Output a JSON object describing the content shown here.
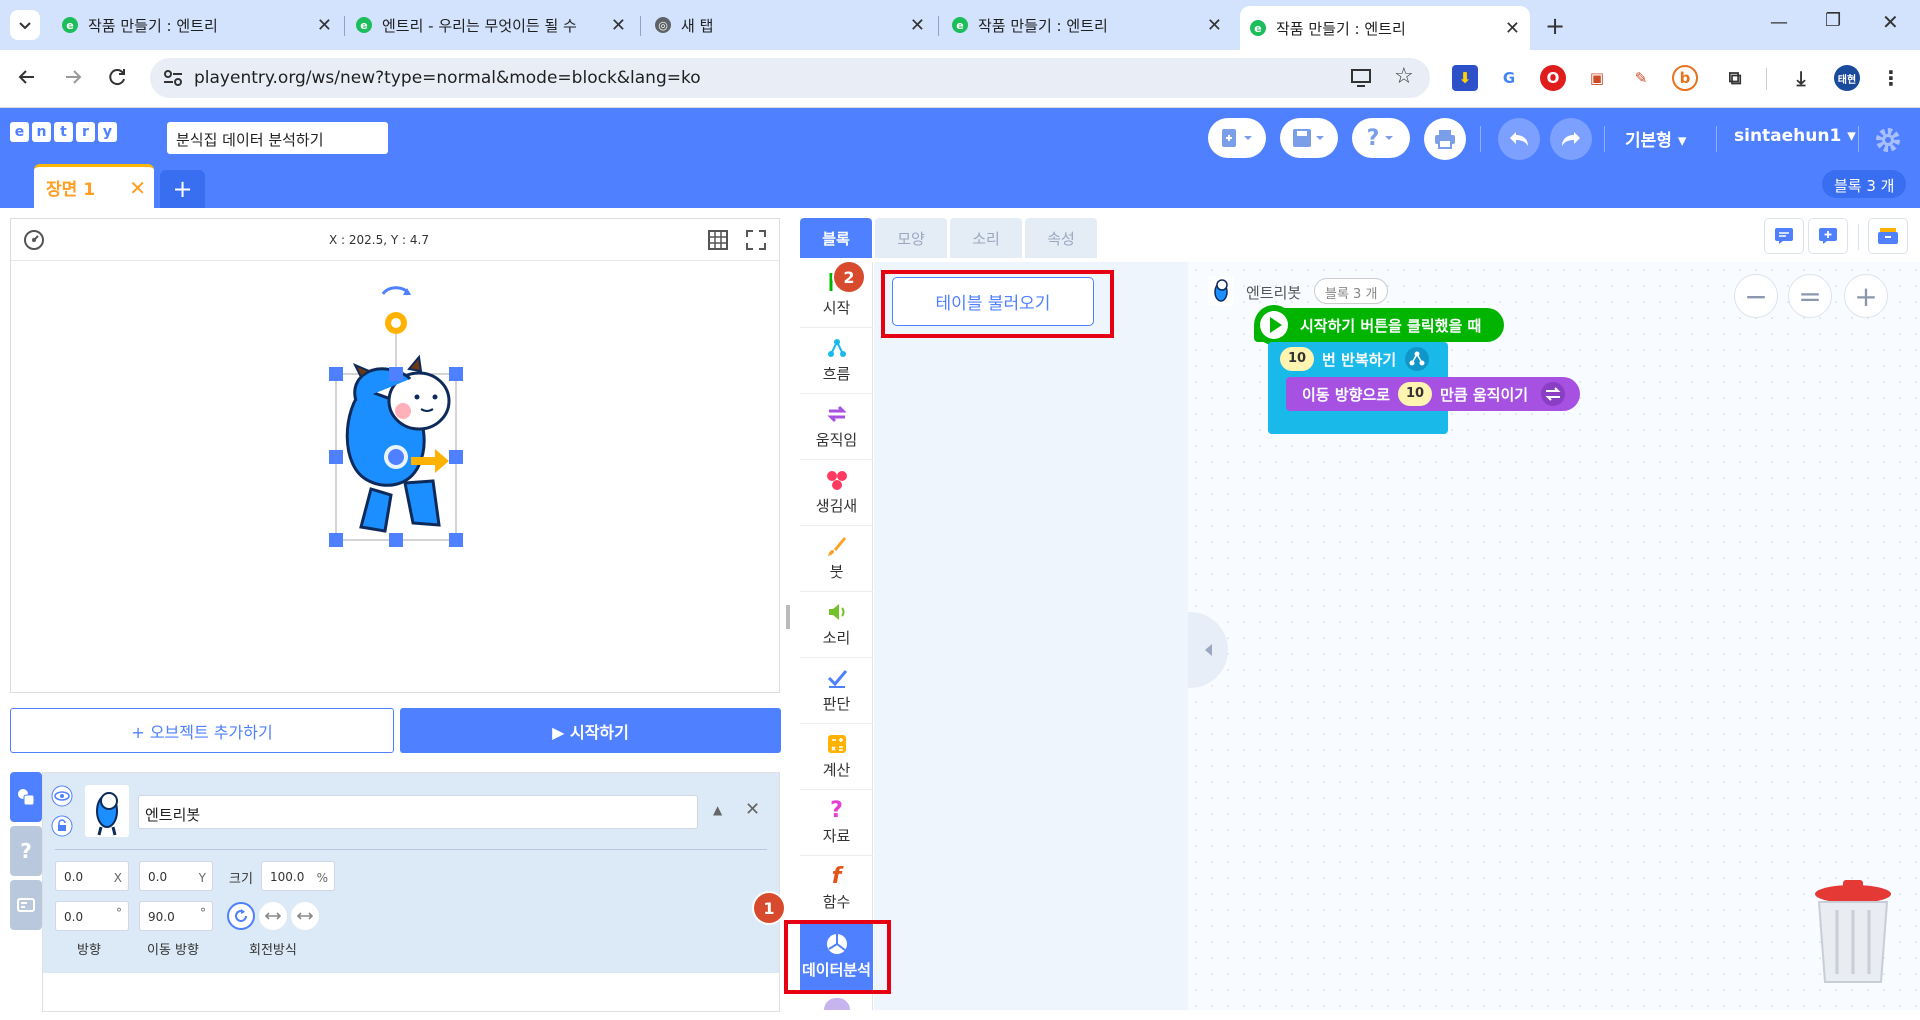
{
  "browser": {
    "tabs": [
      {
        "title": "작품 만들기 : 엔트리"
      },
      {
        "title": "엔트리 - 우리는 무엇이든 될 수"
      },
      {
        "title": "새 탭"
      },
      {
        "title": "작품 만들기 : 엔트리"
      },
      {
        "title": "작품 만들기 : 엔트리"
      }
    ],
    "url": "playentry.org/ws/new?type=normal&mode=block&lang=ko",
    "profile_label": "태현"
  },
  "header": {
    "logo": [
      "e",
      "n",
      "t",
      "r",
      "y"
    ],
    "project_title": "분식집 데이터 분석하기",
    "mode_label": "기본형 ▾",
    "user_label": "sintaehun1 ▾",
    "scene_tab": "장면 1",
    "block_count": "블록 3 개"
  },
  "stage": {
    "coords": "X : 202.5, Y : 4.7",
    "add_object": "+ 오브젝트 추가하기",
    "start": "▶ 시작하기"
  },
  "object": {
    "name": "엔트리봇",
    "x": "0.0",
    "x_unit": "X",
    "y": "0.0",
    "y_unit": "Y",
    "size_label": "크기",
    "size": "100.0",
    "size_unit": "%",
    "direction": "0.0",
    "direction_unit": "°",
    "move_direction": "90.0",
    "move_direction_unit": "°",
    "label_direction": "방향",
    "label_move_direction": "이동 방향",
    "label_rotation": "회전방식"
  },
  "palette": {
    "tabs": [
      "블록",
      "모양",
      "소리",
      "속성"
    ],
    "categories": [
      "시작",
      "흐름",
      "움직임",
      "생김새",
      "붓",
      "소리",
      "판단",
      "계산",
      "자료",
      "함수",
      "데이터분석"
    ],
    "table_load_button": "테이블 불러오기",
    "badge1": "1",
    "badge2": "2"
  },
  "workspace": {
    "object_label": "엔트리봇",
    "block_count": "블록 3 개",
    "block_start": "시작하기 버튼을 클릭했을 때",
    "block_repeat_num": "10",
    "block_repeat": "번 반복하기",
    "block_move_prefix": "이동 방향으로",
    "block_move_num": "10",
    "block_move_suffix": "만큼 움직이기"
  },
  "colors": {
    "brand": "#4f80ff",
    "start_block": "#00b400",
    "flow_block": "#19baea",
    "move_block": "#a751e3",
    "highlight": "#e60012"
  }
}
